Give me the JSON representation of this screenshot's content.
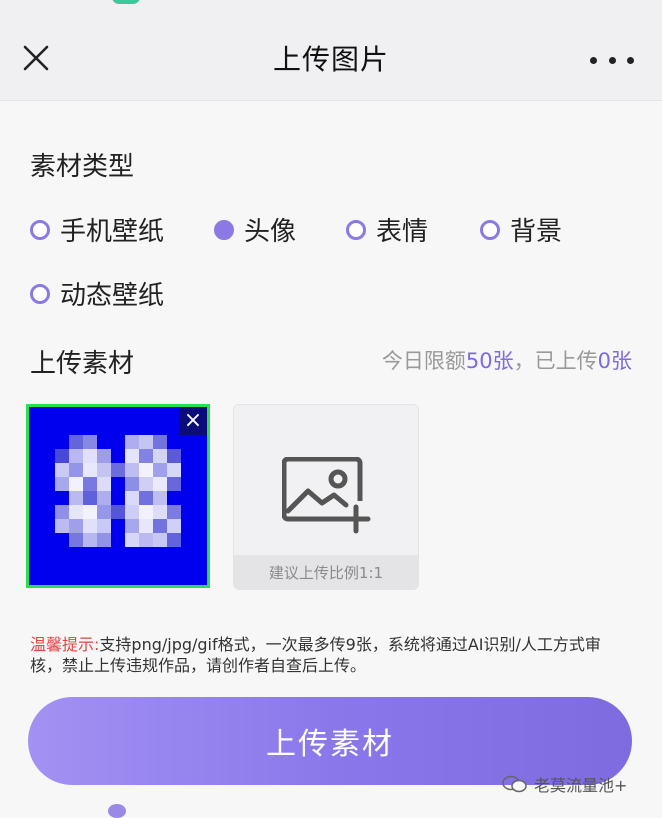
{
  "header": {
    "title": "上传图片"
  },
  "material_type": {
    "title": "素材类型",
    "options": [
      {
        "label": "手机壁纸",
        "selected": false
      },
      {
        "label": "头像",
        "selected": true
      },
      {
        "label": "表情",
        "selected": false
      },
      {
        "label": "背景",
        "selected": false
      },
      {
        "label": "动态壁纸",
        "selected": false
      }
    ]
  },
  "upload_section": {
    "title": "上传素材",
    "quota_prefix": "今日限额",
    "quota_limit": "50张",
    "quota_mid": "，已上传",
    "quota_used": "0张",
    "ratio_hint": "建议上传比例1:1"
  },
  "tips": {
    "label": "温馨提示:",
    "text": "支持png/jpg/gif格式，一次最多传9张，系统将通过AI识别/人工方式审核，禁止上传违规作品，请创作者自查后上传。"
  },
  "upload_button": {
    "label": "上传素材"
  },
  "watermark": {
    "text": "老莫流量池+"
  },
  "colors": {
    "accent": "#8d79e3",
    "thumb_border": "#27e04f",
    "thumb_bg": "#0000ee",
    "warn": "#e14545"
  }
}
